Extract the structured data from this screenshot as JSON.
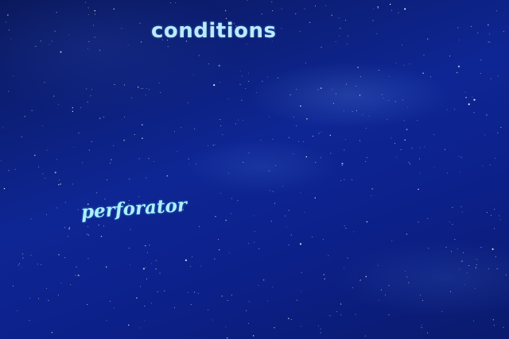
{
  "image": {
    "scene": "night sky",
    "captions": {
      "top": "conditions",
      "script": "perforator"
    },
    "colors": {
      "sky_dark": "#0a175a",
      "sky_mid": "#0e2694",
      "caption_top": "#b8ecff",
      "caption_script": "#a8f2ff",
      "star": "#ffffff"
    }
  }
}
